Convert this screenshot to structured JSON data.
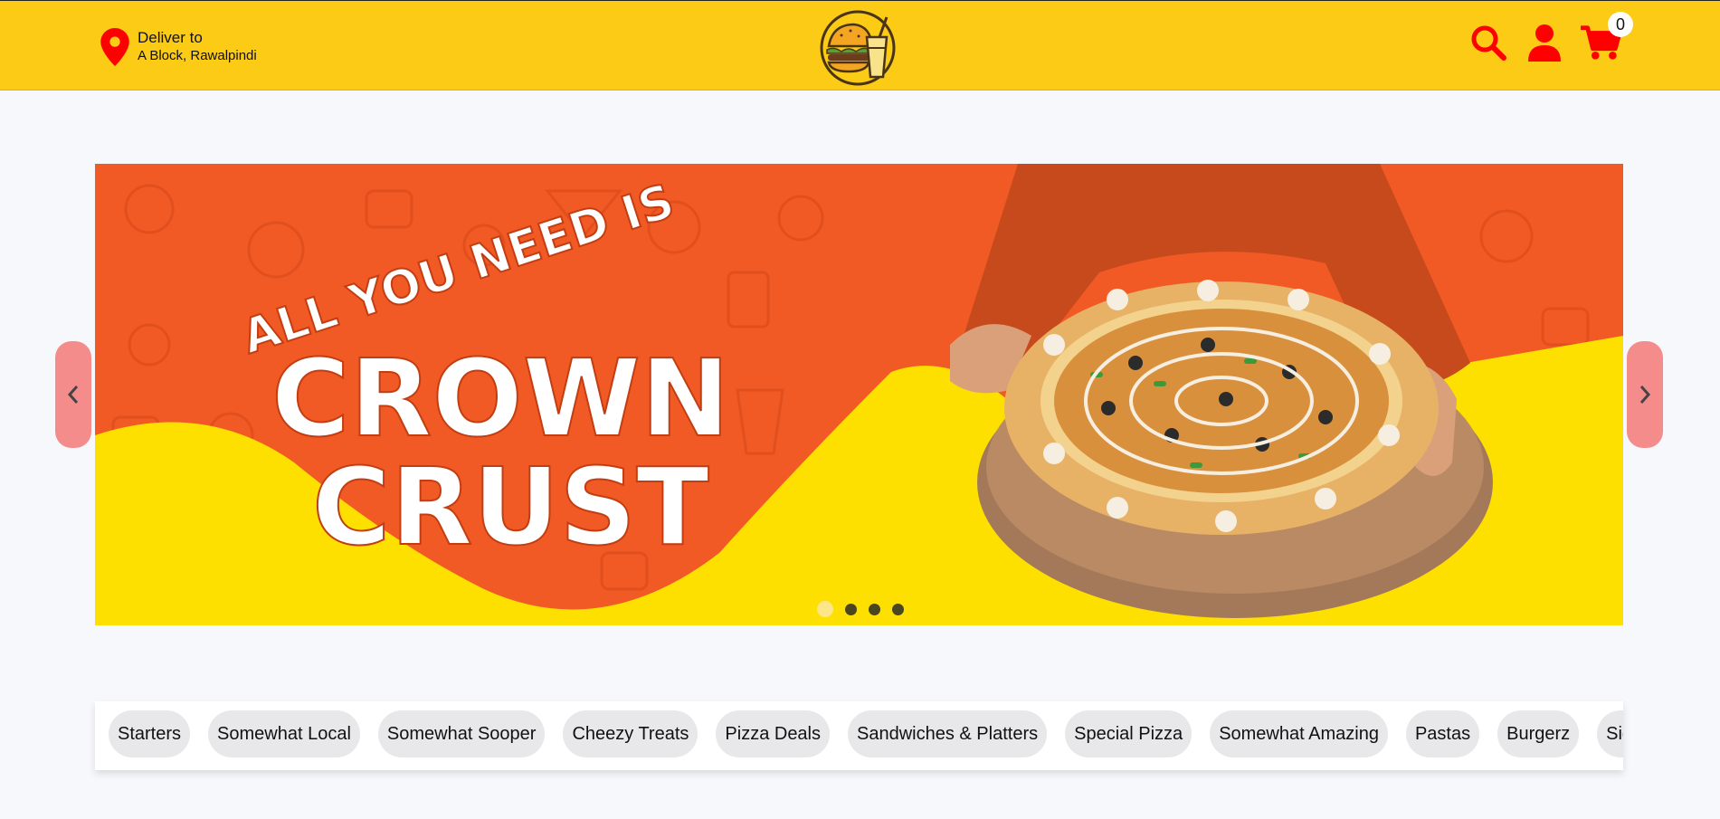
{
  "header": {
    "deliver_label": "Deliver to",
    "deliver_address": "A Block, Rawalpindi",
    "cart_count": "0",
    "brand_color": "#fbcb16",
    "icon_color": "#ff0000",
    "icons": [
      "location-pin-icon",
      "search-icon",
      "user-icon",
      "cart-icon"
    ]
  },
  "banner": {
    "headline_line1": "ALL YOU NEED IS",
    "headline_line2": "CROWN",
    "headline_line3": "CRUST",
    "slide_count": 4,
    "active_slide": 1,
    "colors": {
      "orange": "#f15a24",
      "yellow": "#fde000"
    }
  },
  "categories": [
    "Starters",
    "Somewhat Local",
    "Somewhat Sooper",
    "Cheezy Treats",
    "Pizza Deals",
    "Sandwiches & Platters",
    "Special Pizza",
    "Somewhat Amazing",
    "Pastas",
    "Burgerz",
    "Side"
  ]
}
